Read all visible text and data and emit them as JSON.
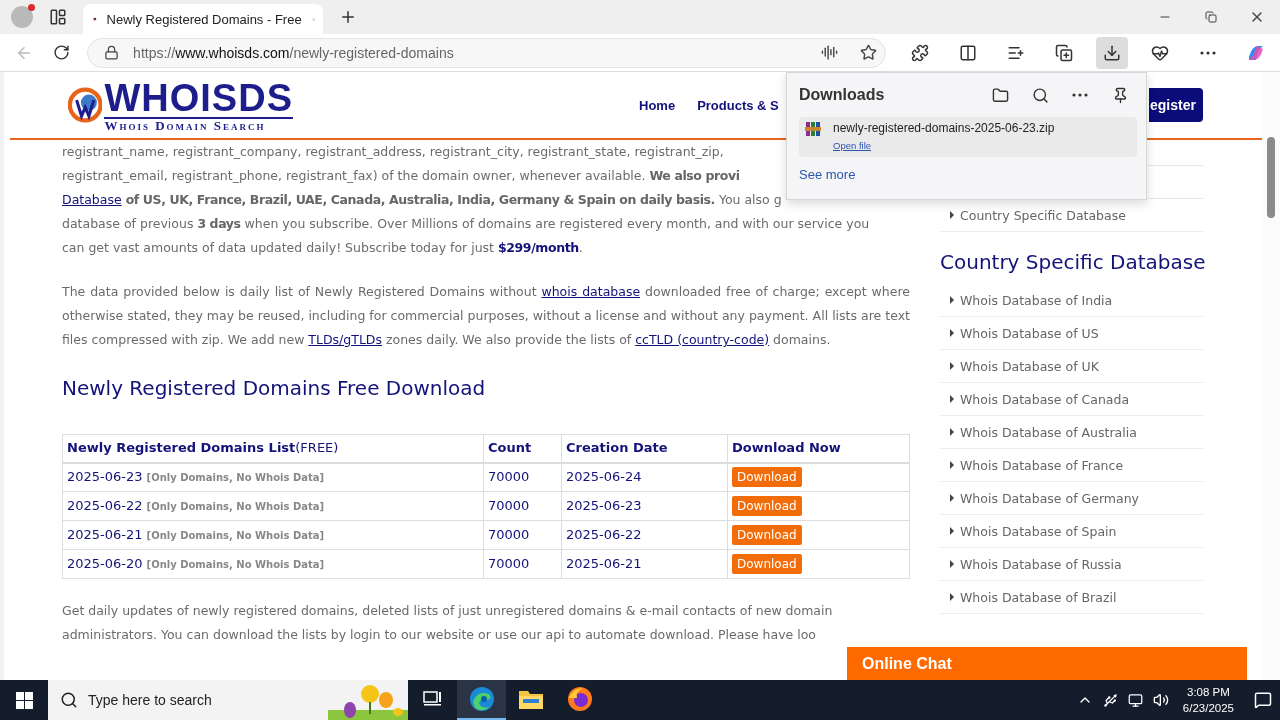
{
  "browser": {
    "tab": {
      "title": "Newly Registered Domains - Free"
    },
    "address": {
      "scheme": "https://",
      "host": "www.whoisds.com",
      "path": "/newly-registered-domains"
    },
    "toolbar": [
      {
        "kind": "extensions",
        "selected": false
      },
      {
        "kind": "split",
        "selected": false
      },
      {
        "kind": "favorites",
        "selected": false
      },
      {
        "kind": "collections",
        "selected": false
      },
      {
        "kind": "downloads",
        "selected": true
      },
      {
        "kind": "health",
        "selected": false
      },
      {
        "kind": "more",
        "selected": false
      },
      {
        "kind": "copilot",
        "selected": false
      }
    ]
  },
  "downloads_panel": {
    "title": "Downloads",
    "file": "newly-registered-domains-2025-06-23.zip",
    "action": "Open file",
    "see_more": "See more"
  },
  "site": {
    "logo": {
      "name": "WHOISDS",
      "tagline": "Whois Domain Search"
    },
    "nav": [
      "Home",
      "Products & S"
    ],
    "register": "egister",
    "intro_lines": [
      [
        {
          "kind": "text",
          "text": "registrant_name,  registrant_company,  registrant_address,  registrant_city,  registrant_state,  registrant_zip,"
        }
      ],
      [
        {
          "kind": "text",
          "text": "registrant_email, registrant_phone, registrant_fax) of the domain owner, whenever available. **We also provi**"
        }
      ],
      [
        {
          "kind": "link",
          "text": "Database"
        },
        {
          "kind": "text",
          "text": " **of US, UK, France, Brazil, UAE, Canada, Australia, India, Germany & Spain on daily basis.** You also g"
        }
      ],
      [
        {
          "kind": "text",
          "text": "database of previous **3 days** when you subscribe. Over Millions of domains are registered every month, and with our service you"
        }
      ],
      [
        {
          "kind": "text",
          "text": "can get vast amounts of data updated daily! Subscribe today for just **$299/month**."
        }
      ]
    ],
    "about": [
      {
        "kind": "text",
        "text": "The data provided below is daily list of Newly Registered Domains without "
      },
      {
        "kind": "link",
        "text": "whois database"
      },
      {
        "kind": "text",
        "text": " downloaded free of charge; except where otherwise stated, they may be reused, including for commercial purposes, without a license and without any payment. All lists are text files compressed with zip. We add new "
      },
      {
        "kind": "link",
        "text": "TLDs/gTLDs"
      },
      {
        "kind": "text",
        "text": " zones daily. We also provide the lists of "
      },
      {
        "kind": "link",
        "text": "ccTLD (country-code)"
      },
      {
        "kind": "text",
        "text": " domains."
      }
    ],
    "section_title": "Newly Registered Domains Free Download",
    "table": {
      "columns": [
        {
          "title": "Newly Registered Domains List",
          "suffix": "(FREE)"
        },
        {
          "title": "Count"
        },
        {
          "title": "Creation Date"
        },
        {
          "title": "Download Now"
        }
      ],
      "rows": [
        {
          "date": "2025-06-23",
          "note": "[Only Domains, No Whois Data]",
          "count": "70000",
          "created": "2025-06-24",
          "action": "Download"
        },
        {
          "date": "2025-06-22",
          "note": "[Only Domains, No Whois Data]",
          "count": "70000",
          "created": "2025-06-23",
          "action": "Download"
        },
        {
          "date": "2025-06-21",
          "note": "[Only Domains, No Whois Data]",
          "count": "70000",
          "created": "2025-06-22",
          "action": "Download"
        },
        {
          "date": "2025-06-20",
          "note": "[Only Domains, No Whois Data]",
          "count": "70000",
          "created": "2025-06-21",
          "action": "Download"
        }
      ]
    },
    "footer_lines": [
      "Get daily updates of newly registered domains, deleted lists of just unregistered domains & e-mail contacts of new domain",
      "administrators. You can download the lists by login to our website or use our api to automate download. Please have loo"
    ],
    "sidebar": {
      "top_items": [
        "Country Specific Database"
      ],
      "heading": "Country Specific Database",
      "items": [
        "Whois Database of India",
        "Whois Database of US",
        "Whois Database of UK",
        "Whois Database of Canada",
        "Whois Database of Australia",
        "Whois Database of France",
        "Whois Database of Germany",
        "Whois Database of Spain",
        "Whois Database of Russia",
        "Whois Database of Brazil"
      ]
    },
    "chat": "Online Chat"
  },
  "taskbar": {
    "search_placeholder": "Type here to search",
    "apps": [
      {
        "kind": "taskview",
        "selected": false
      },
      {
        "kind": "edge",
        "selected": true
      },
      {
        "kind": "explorer",
        "selected": false
      },
      {
        "kind": "firefox",
        "selected": false
      }
    ],
    "time": "3:08 PM",
    "date": "6/23/2025"
  }
}
